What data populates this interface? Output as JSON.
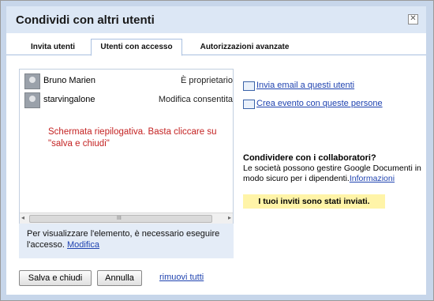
{
  "dialog": {
    "title": "Condividi con altri utenti",
    "close_glyph": "✕"
  },
  "tabs": [
    {
      "label": "Invita utenti",
      "active": false
    },
    {
      "label": "Utenti con accesso",
      "active": true
    },
    {
      "label": "Autorizzazioni avanzate",
      "active": false
    }
  ],
  "users": [
    {
      "name": "Bruno Marien",
      "role": "È proprietario"
    },
    {
      "name": "starvingalone",
      "role": "Modifica consentita"
    }
  ],
  "annotation": "Schermata riepilogativa. Basta cliccare su \"salva e chiudi\"",
  "scrollbar": {
    "left_arrow": "◂",
    "right_arrow": "▸",
    "grip": "III"
  },
  "access_message": {
    "text": "Per visualizzare l'elemento, è necessario eseguire l'accesso.",
    "link": "Modifica"
  },
  "actions": [
    {
      "label": "Invia email a questi utenti",
      "icon": "email-icon"
    },
    {
      "label": "Crea evento con queste persone",
      "icon": "calendar-icon"
    }
  ],
  "collaborators": {
    "title": "Condividere con i collaboratori?",
    "text": "Le società possono gestire Google Documenti in modo sicuro per i dipendenti.",
    "link": "Informazioni"
  },
  "notice": "I tuoi inviti sono stati inviati.",
  "footer": {
    "save_label": "Salva e chiudi",
    "cancel_label": "Annulla",
    "remove_all_label": "rimuovi tutti"
  },
  "colors": {
    "frame": "#c7d6ea",
    "titlebar": "#dce7f5",
    "link": "#1f43b0",
    "annotation": "#c42323",
    "notice_bg": "#fff4a8"
  }
}
